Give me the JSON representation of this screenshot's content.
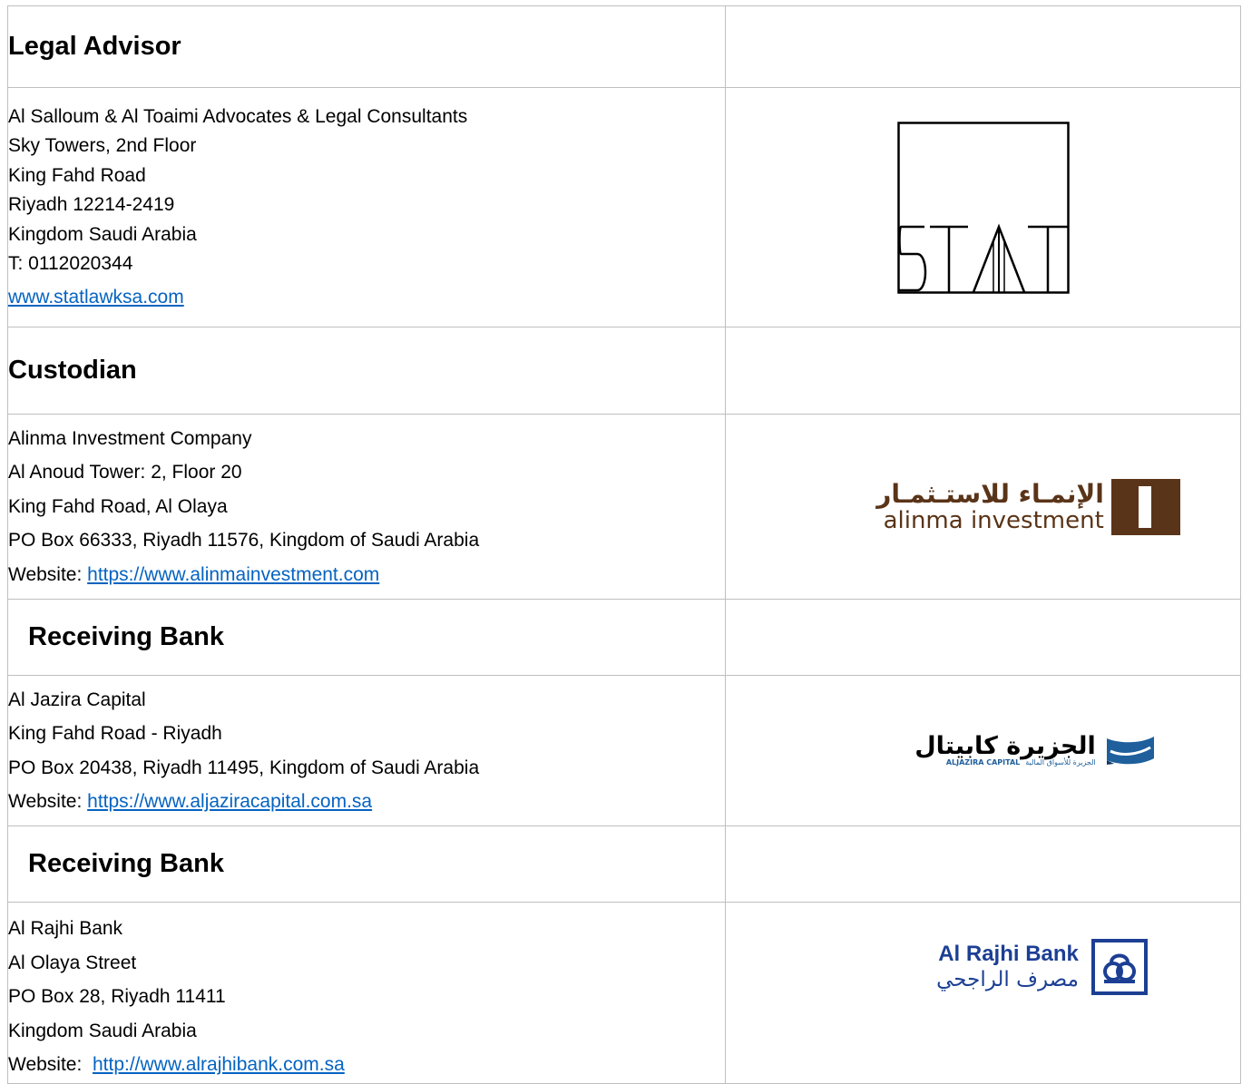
{
  "sections": [
    {
      "heading": "Legal Advisor",
      "lines": [
        "Al Salloum & Al Toaimi Advocates & Legal Consultants",
        "Sky Towers, 2nd Floor",
        "King Fahd Road",
        "Riyadh 12214-2419",
        "Kingdom Saudi Arabia",
        "T: 0112020344"
      ],
      "website_prefix": "",
      "website": "www.statlawksa.com",
      "logo": {
        "name": "stat-logo",
        "text": "STAT"
      }
    },
    {
      "heading": "Custodian",
      "lines": [
        "Alinma Investment Company",
        "Al Anoud Tower: 2, Floor 20",
        "King Fahd Road, Al Olaya",
        "PO Box 66333, Riyadh 11576, Kingdom of Saudi Arabia"
      ],
      "website_prefix": "Website: ",
      "website": "https://www.alinmainvestment.com",
      "logo": {
        "name": "alinma-investment-logo",
        "arabic": "الإنمـاء للاستـثمـار",
        "latin": "alinma investment"
      }
    },
    {
      "heading": "Receiving Bank",
      "lines": [
        "Al Jazira Capital",
        "King Fahd Road - Riyadh",
        "PO Box 20438, Riyadh 11495, Kingdom of Saudi Arabia"
      ],
      "website_prefix": "Website: ",
      "website": "https://www.aljaziracapital.com.sa",
      "logo": {
        "name": "aljazira-capital-logo",
        "arabic": "الجزيرة كابيتال",
        "small_arabic": "الجزيرة للأسواق المالية",
        "latin": "ALJAZIRA CAPITAL"
      }
    },
    {
      "heading": "Receiving Bank",
      "lines": [
        "Al Rajhi Bank",
        "Al Olaya Street",
        "PO Box 28, Riyadh 11411",
        "Kingdom Saudi Arabia"
      ],
      "website_prefix": "Website:  ",
      "website": "http://www.alrajhibank.com.sa",
      "logo": {
        "name": "alrajhi-bank-logo",
        "latin": "Al Rajhi Bank",
        "arabic": "مصرف الراجحي"
      }
    }
  ],
  "colors": {
    "border": "#bfbfbf",
    "link": "#0563c1",
    "alinma_brown": "#5a3418",
    "aljazira_blue": "#1e5f9c",
    "alrajhi_blue": "#1c3f94"
  }
}
